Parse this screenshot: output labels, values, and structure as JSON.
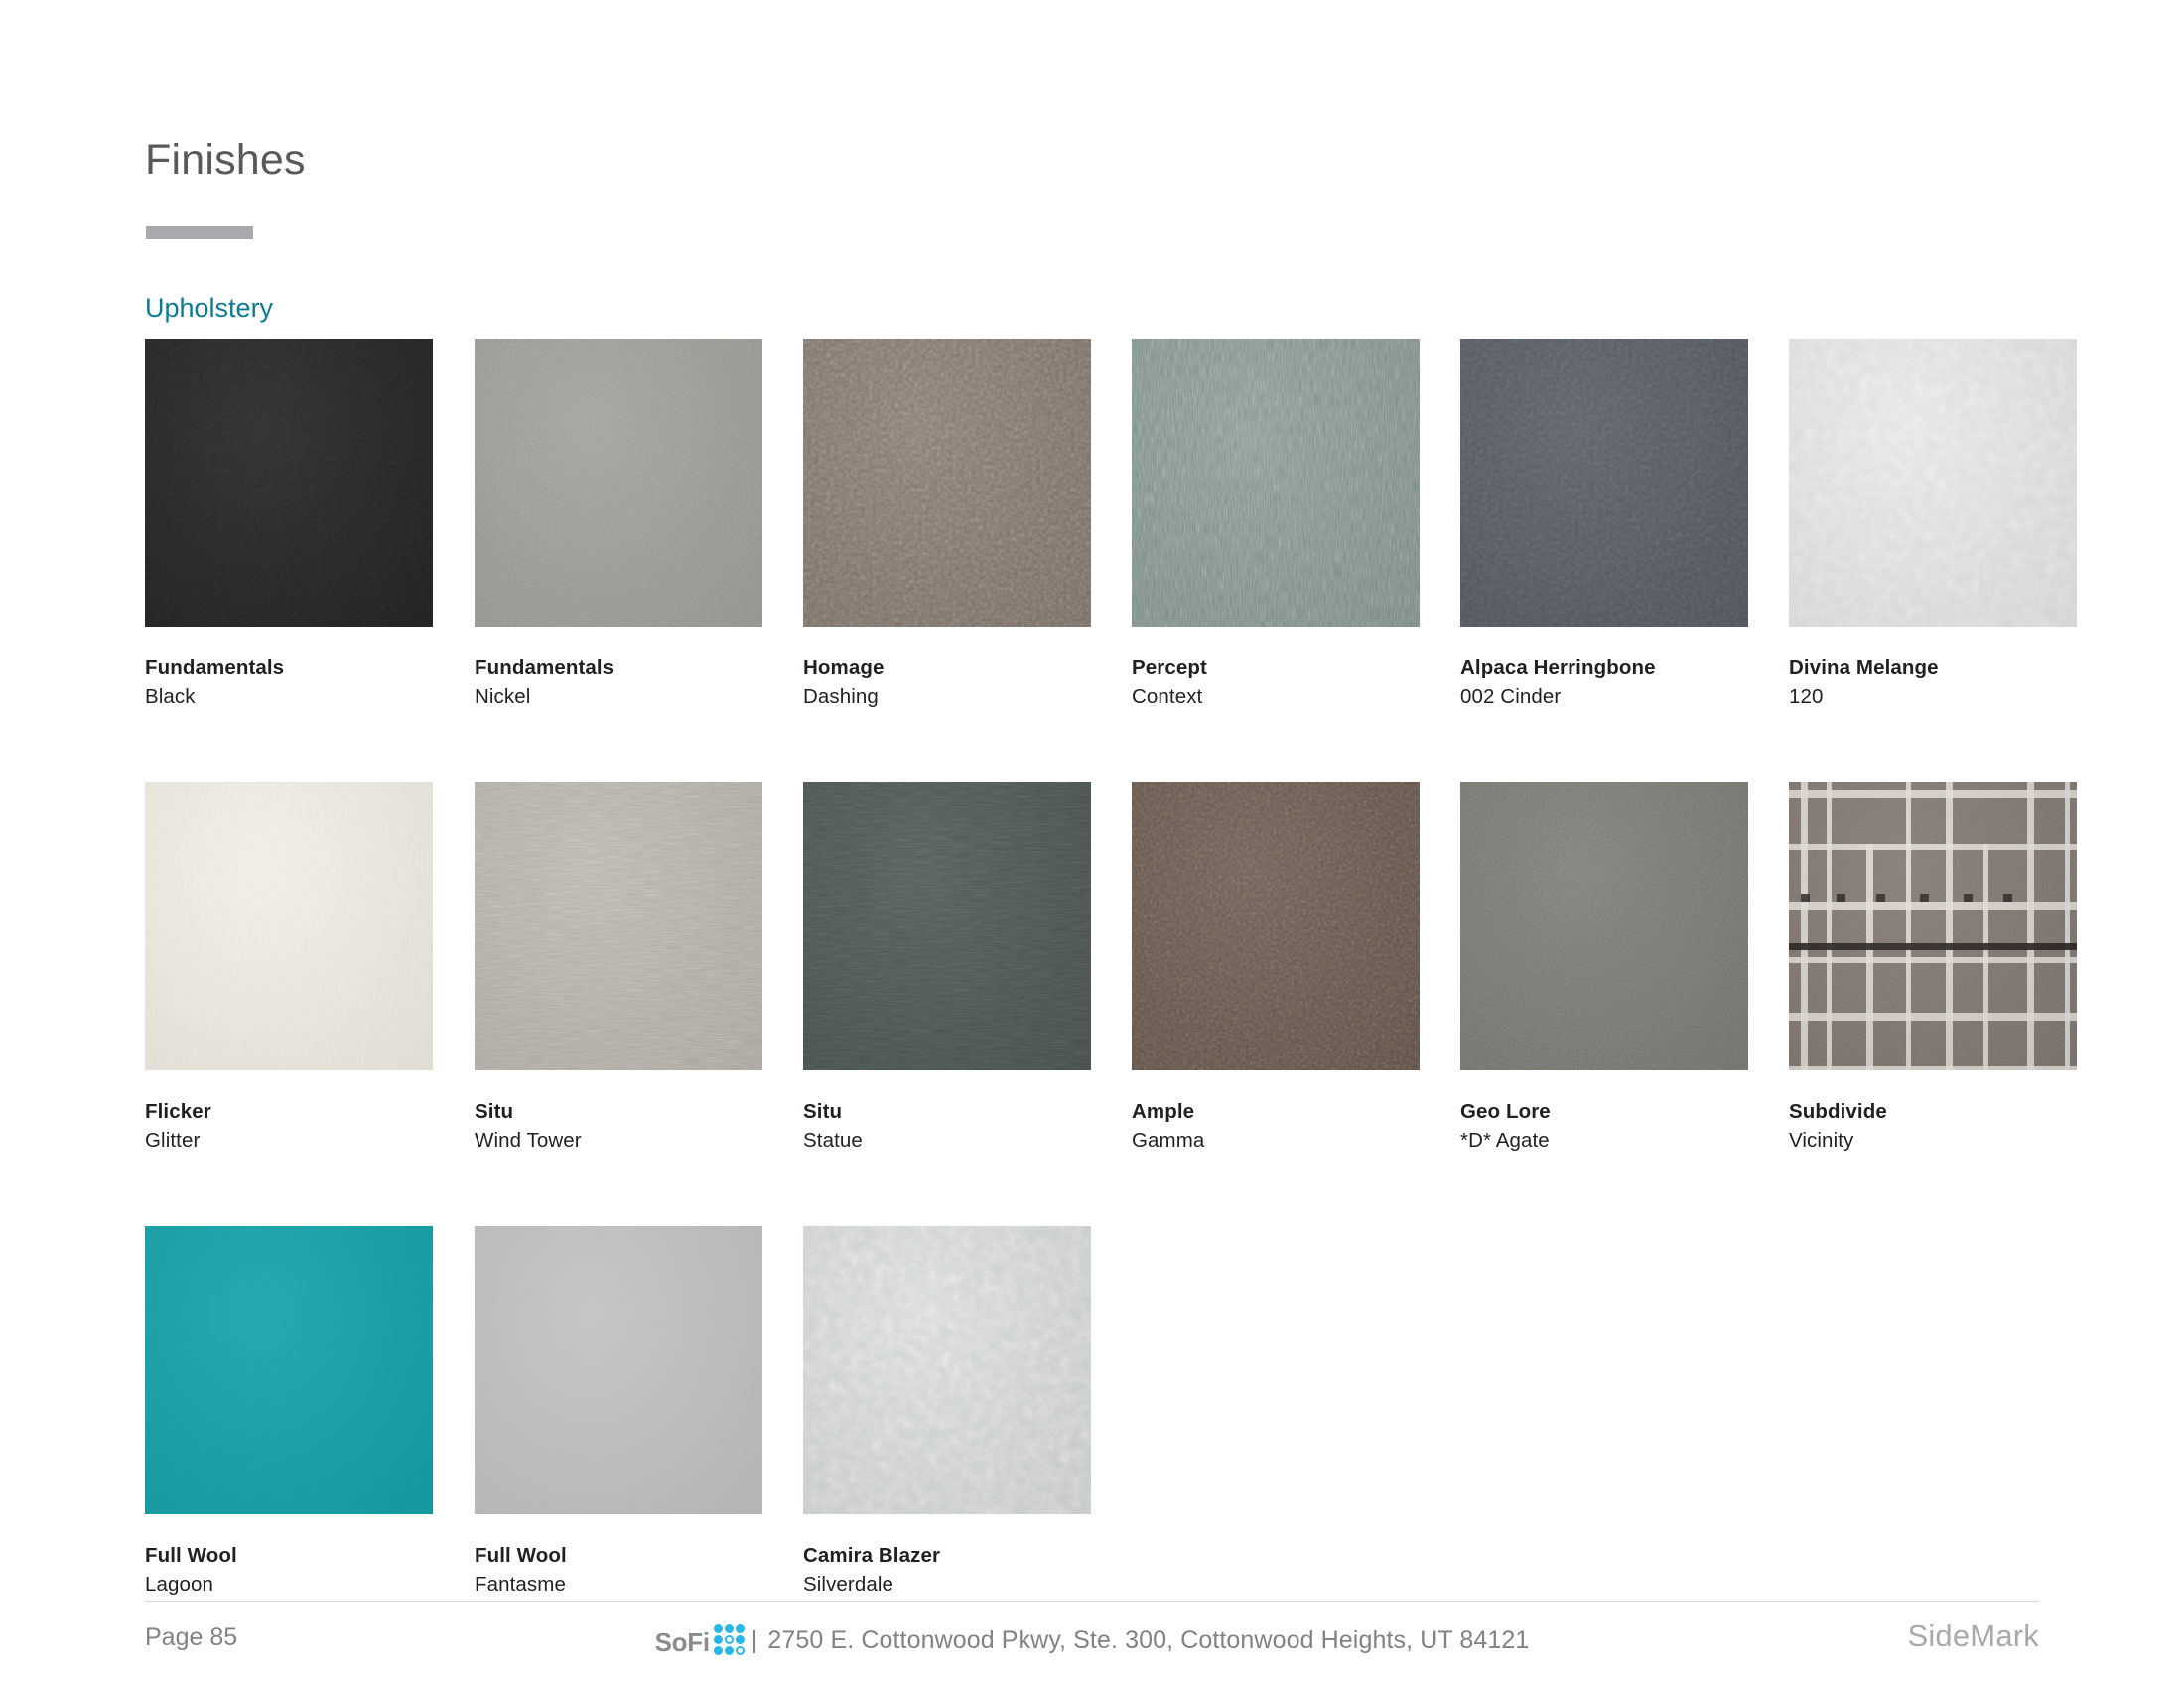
{
  "page": {
    "title": "Finishes",
    "section": "Upholstery"
  },
  "footer": {
    "page_label": "Page 85",
    "logo_text": "SoFi",
    "separator": "|",
    "address": "2750 E. Cottonwood Pkwy, Ste. 300, Cottonwood Heights, UT 84121",
    "brand": "SideMark",
    "accent_color": "#29b6e8"
  },
  "colors": {
    "heading": "#58595b",
    "section_accent": "#0a7b96",
    "rule": "#a7a9ac",
    "caption": "#231f20",
    "footer_text": "#808285"
  },
  "swatches": [
    [
      {
        "name": "Fundamentals",
        "color": "Black",
        "swatch_hex": "#242322",
        "texture": "diamond-weave"
      },
      {
        "name": "Fundamentals",
        "color": "Nickel",
        "swatch_hex": "#9a9a94",
        "texture": "fine-weave"
      },
      {
        "name": "Homage",
        "color": "Dashing",
        "swatch_hex": "#7e746b",
        "texture": "boucle"
      },
      {
        "name": "Percept",
        "color": "Context",
        "swatch_hex": "#7e918c",
        "texture": "vertical-striate"
      },
      {
        "name": "Alpaca Herringbone",
        "color": "002 Cinder",
        "swatch_hex": "#54585f",
        "texture": "herringbone"
      },
      {
        "name": "Divina Melange",
        "color": "120",
        "swatch_hex": "#e3e3e1",
        "texture": "melange-felt"
      }
    ],
    [
      {
        "name": "Flicker",
        "color": "Glitter",
        "swatch_hex": "#efece2",
        "texture": "vertical-rib"
      },
      {
        "name": "Situ",
        "color": "Wind Tower",
        "swatch_hex": "#b3b0a8",
        "texture": "horizontal-slub"
      },
      {
        "name": "Situ",
        "color": "Statue",
        "swatch_hex": "#4a5250",
        "texture": "horizontal-slub"
      },
      {
        "name": "Ample",
        "color": "Gamma",
        "swatch_hex": "#61544a",
        "texture": "basketweave"
      },
      {
        "name": "Geo Lore",
        "color": "*D* Agate",
        "swatch_hex": "#767570",
        "texture": "fine-weave"
      },
      {
        "name": "Subdivide",
        "color": "Vicinity",
        "swatch_hex": "#7d736e",
        "texture": "grid-lines"
      }
    ],
    [
      {
        "name": "Full Wool",
        "color": "Lagoon",
        "swatch_hex": "#15a0a8",
        "texture": "solid-felt"
      },
      {
        "name": "Full Wool",
        "color": "Fantasme",
        "swatch_hex": "#bfc0c0",
        "texture": "solid-felt"
      },
      {
        "name": "Camira Blazer",
        "color": "Silverdale",
        "swatch_hex": "#d3d8d3",
        "texture": "melange-felt"
      }
    ]
  ]
}
